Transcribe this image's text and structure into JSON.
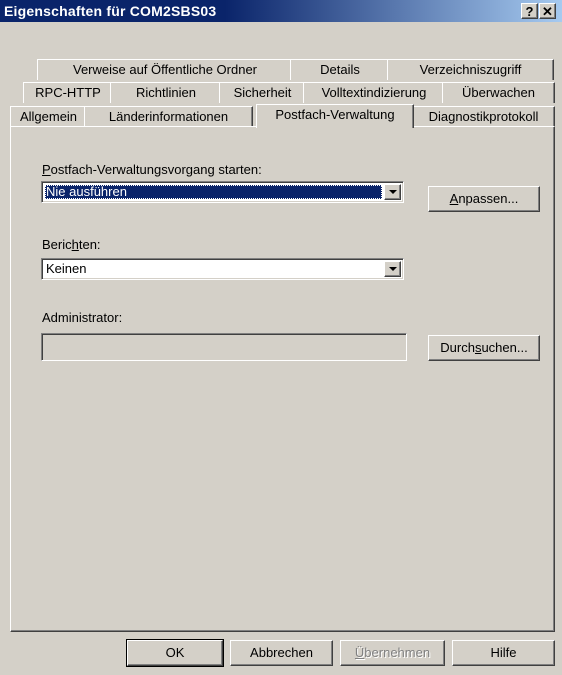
{
  "window": {
    "title": "Eigenschaften für COM2SBS03",
    "help_glyph": "?",
    "close_glyph": "✕"
  },
  "tabs": {
    "row1": [
      "Verweise auf Öffentliche Ordner",
      "Details",
      "Verzeichniszugriff"
    ],
    "row2": [
      "RPC-HTTP",
      "Richtlinien",
      "Sicherheit",
      "Volltextindizierung",
      "Überwachen"
    ],
    "row3": [
      "Allgemein",
      "Länderinformationen",
      "Postfach-Verwaltung",
      "Diagnostikprotokoll"
    ],
    "active": "Postfach-Verwaltung"
  },
  "panel": {
    "start_label": {
      "u": "P",
      "rest": "ostfach-Verwaltungsvorgang starten:"
    },
    "start_value": "Nie ausführen",
    "customize_button": {
      "u": "A",
      "rest": "npassen..."
    },
    "report_label": {
      "pre": "Beric",
      "u": "h",
      "rest": "ten:"
    },
    "report_value": "Keinen",
    "admin_label": "Administrator:",
    "admin_value": "",
    "browse_button": {
      "pre": "Durch",
      "u": "s",
      "rest": "uchen..."
    }
  },
  "footer": {
    "ok": "OK",
    "cancel": "Abbrechen",
    "apply": {
      "u": "Ü",
      "rest": "bernehmen"
    },
    "help": "Hilfe"
  }
}
